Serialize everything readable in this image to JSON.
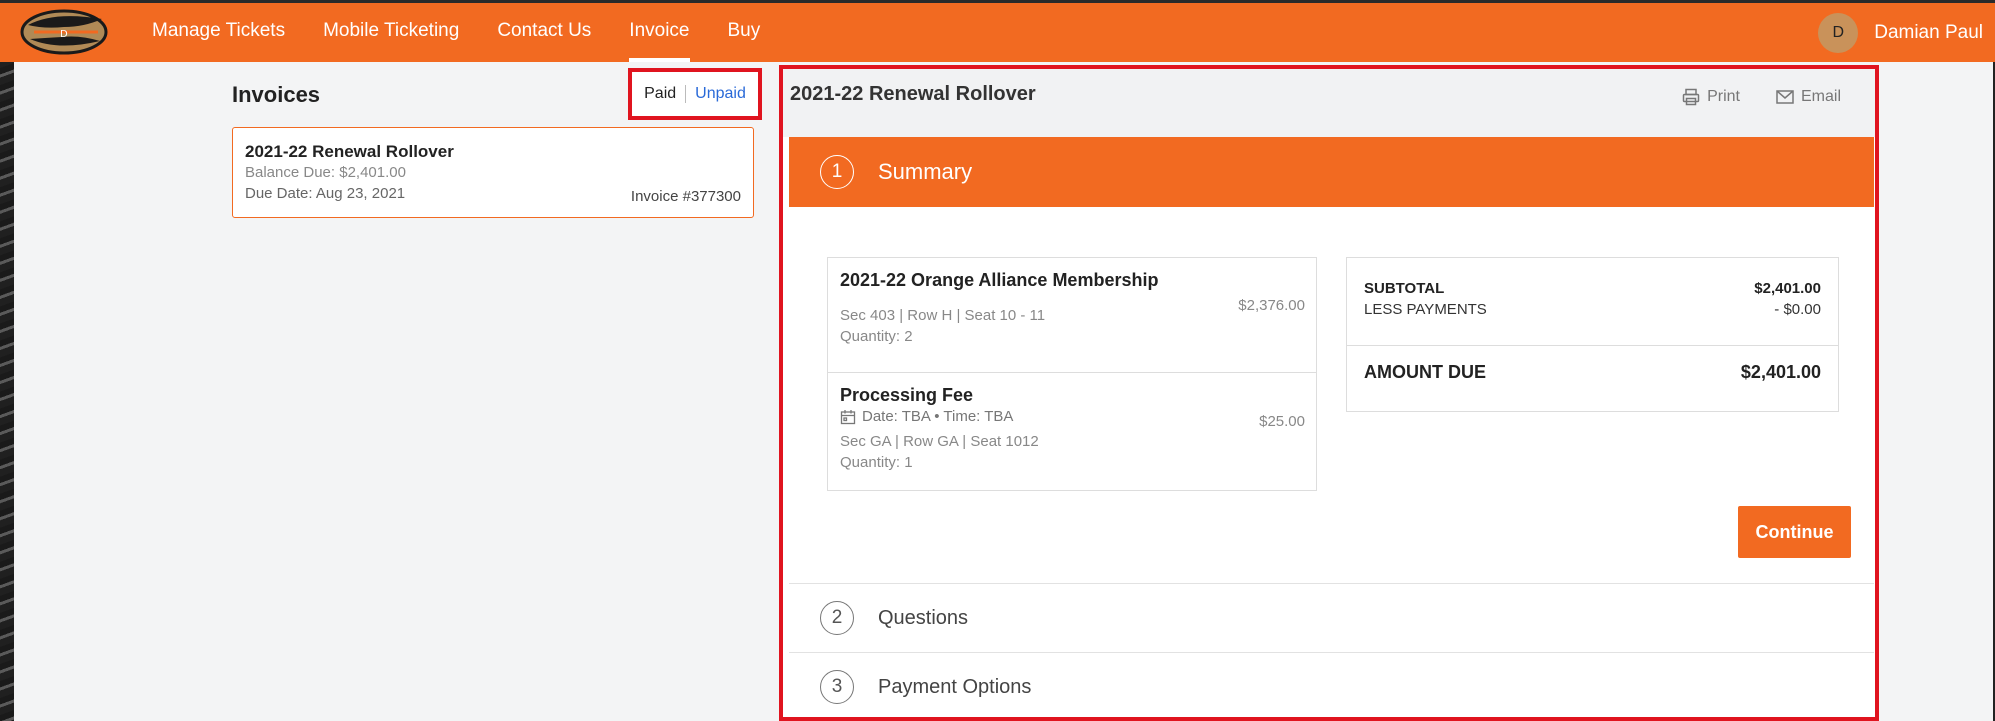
{
  "nav": {
    "logo_text": "2021 Ducks",
    "items": [
      {
        "label": "Manage Tickets",
        "active": false
      },
      {
        "label": "Mobile Ticketing",
        "active": false
      },
      {
        "label": "Contact Us",
        "active": false
      },
      {
        "label": "Invoice",
        "active": true
      },
      {
        "label": "Buy",
        "active": false
      }
    ],
    "user": {
      "initial": "D",
      "name": "Damian Paul"
    }
  },
  "invoices": {
    "title": "Invoices",
    "filter": {
      "paid": "Paid",
      "unpaid": "Unpaid"
    },
    "card": {
      "title": "2021-22 Renewal Rollover",
      "balance": "Balance Due: $2,401.00",
      "due_date": "Due Date: Aug 23, 2021",
      "number": "Invoice #377300"
    }
  },
  "detail": {
    "title": "2021-22 Renewal Rollover",
    "actions": {
      "print": "Print",
      "email": "Email"
    },
    "steps": [
      {
        "num": "1",
        "label": "Summary"
      },
      {
        "num": "2",
        "label": "Questions"
      },
      {
        "num": "3",
        "label": "Payment Options"
      }
    ],
    "items": [
      {
        "name": "2021-22 Orange Alliance Membership",
        "price": "$2,376.00",
        "seats": "Sec 403 | Row H  |  Seat 10 - 11",
        "quantity": "Quantity: 2"
      },
      {
        "name": "Processing Fee",
        "date": "Date: TBA • Time: TBA",
        "price": "$25.00",
        "seats": "Sec GA | Row GA  |  Seat 1012",
        "quantity": "Quantity: 1"
      }
    ],
    "totals": {
      "subtotal_label": "SUBTOTAL",
      "subtotal_value": "$2,401.00",
      "less_label": "LESS PAYMENTS",
      "less_value": "- $0.00",
      "due_label": "AMOUNT DUE",
      "due_value": "$2,401.00"
    },
    "continue_label": "Continue"
  },
  "colors": {
    "brand_orange": "#f26a21",
    "highlight_red": "#e0141f",
    "link_blue": "#2a6ad8"
  }
}
